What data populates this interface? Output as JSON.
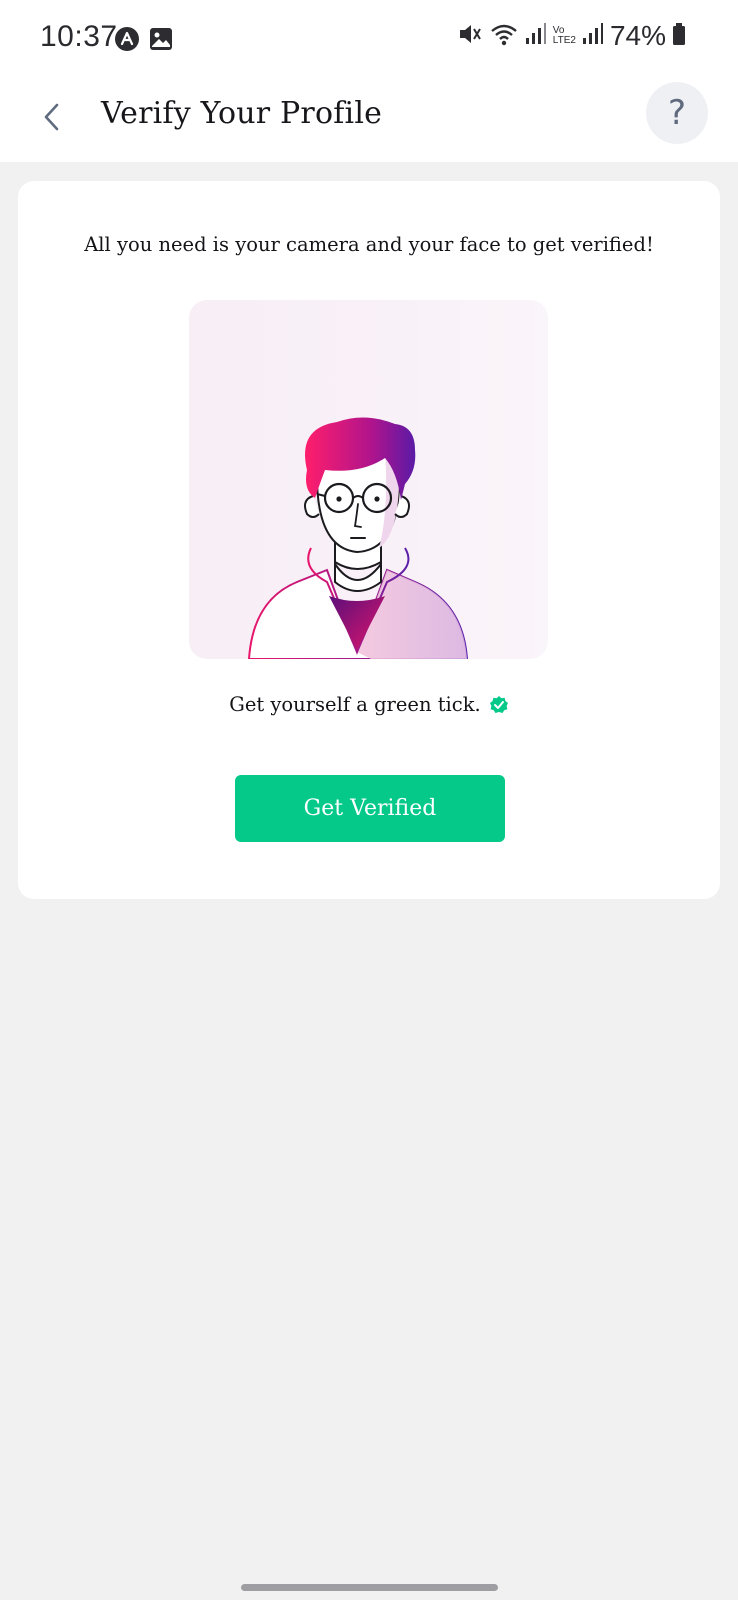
{
  "status_bar": {
    "time": "10:37",
    "battery": "74%",
    "icons": [
      "app-notification-icon",
      "image-notification-icon",
      "mute-vibrate-icon",
      "wifi-icon",
      "signal-icon",
      "volte-icon",
      "battery-icon"
    ],
    "volte_top": "Vo",
    "volte_bottom": "LTE2"
  },
  "header": {
    "title": "Verify Your Profile",
    "back_icon": "chevron-left-icon",
    "help_label": "?"
  },
  "card": {
    "intro": "All you need is your camera and your face to get verified!",
    "tick_text": "Get yourself a green tick.",
    "button_label": "Get Verified"
  },
  "colors": {
    "accent_green": "#05c989",
    "illustration_magenta": "#e8156b",
    "illustration_purple": "#5a1fa8",
    "page_bg": "#f1f1f2"
  }
}
